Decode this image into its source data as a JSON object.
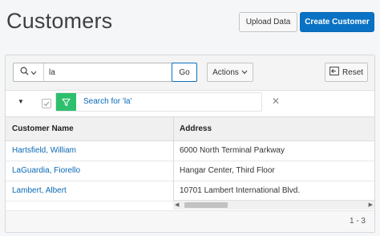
{
  "page": {
    "title": "Customers"
  },
  "header_buttons": {
    "upload": "Upload Data",
    "create": "Create Customer"
  },
  "toolbar": {
    "search_value": "la",
    "go_label": "Go",
    "actions_label": "Actions",
    "reset_label": "Reset"
  },
  "filter": {
    "text": "Search for 'la'",
    "remove_symbol": "✕"
  },
  "table": {
    "columns": [
      "Customer Name",
      "Address"
    ],
    "rows": [
      {
        "name": "Hartsfield, William",
        "address": "6000 North Terminal Parkway"
      },
      {
        "name": "LaGuardia, Fiorello",
        "address": "Hangar Center, Third Floor"
      },
      {
        "name": "Lambert, Albert",
        "address": "10701 Lambert International Blvd."
      }
    ]
  },
  "pagination": {
    "text": "1 - 3"
  },
  "colors": {
    "primary": "#0a72c4",
    "link": "#0a6ab6",
    "filter_green": "#2ebf6d"
  }
}
